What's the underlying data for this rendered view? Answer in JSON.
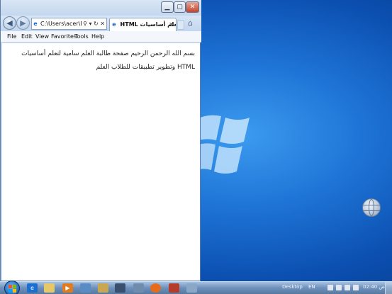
{
  "window": {
    "address": "C:\\Users\\acer\\Desk",
    "address_tools": "⚲ ▾ ↻ ✕",
    "tab_title": "HTML سرة تعلم أساسيات",
    "tab_close": "✕",
    "menu": [
      "File",
      "Edit",
      "View",
      "Favorites",
      "Tools",
      "Help"
    ],
    "content_text": "بسم الله الرحمن الرحيم صفحة طالبة العلم سامية لتعلم أساسيات HTML وتطوير تطبيقات للطلاب العلم"
  },
  "taskbar": {
    "desktop_label": "Desktop",
    "language": "EN",
    "clock": "02:40 ص",
    "pinned_icons": [
      "ie-icon",
      "explorer-icon",
      "media-player-icon",
      "paint-icon",
      "tool-icon",
      "firefox-icon",
      "app-icon",
      "app-icon"
    ]
  },
  "colors": {
    "desktop_blue": "#1e74d6",
    "window_frame": "#c5d9ef",
    "taskbar": "#6d8fbc"
  }
}
